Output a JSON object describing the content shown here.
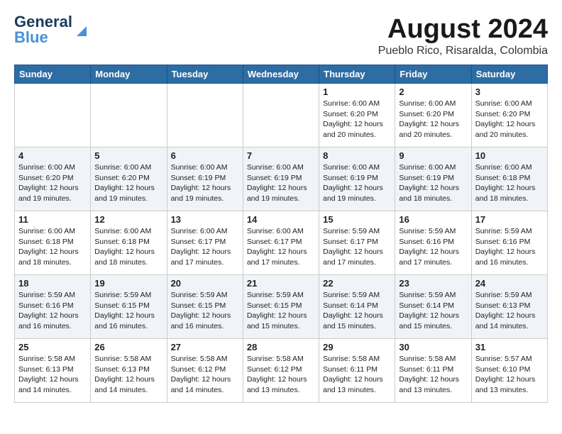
{
  "header": {
    "logo_line1": "General",
    "logo_line2": "Blue",
    "title": "August 2024",
    "subtitle": "Pueblo Rico, Risaralda, Colombia"
  },
  "weekdays": [
    "Sunday",
    "Monday",
    "Tuesday",
    "Wednesday",
    "Thursday",
    "Friday",
    "Saturday"
  ],
  "weeks": [
    [
      {
        "day": "",
        "info": ""
      },
      {
        "day": "",
        "info": ""
      },
      {
        "day": "",
        "info": ""
      },
      {
        "day": "",
        "info": ""
      },
      {
        "day": "1",
        "info": "Sunrise: 6:00 AM\nSunset: 6:20 PM\nDaylight: 12 hours\nand 20 minutes."
      },
      {
        "day": "2",
        "info": "Sunrise: 6:00 AM\nSunset: 6:20 PM\nDaylight: 12 hours\nand 20 minutes."
      },
      {
        "day": "3",
        "info": "Sunrise: 6:00 AM\nSunset: 6:20 PM\nDaylight: 12 hours\nand 20 minutes."
      }
    ],
    [
      {
        "day": "4",
        "info": "Sunrise: 6:00 AM\nSunset: 6:20 PM\nDaylight: 12 hours\nand 19 minutes."
      },
      {
        "day": "5",
        "info": "Sunrise: 6:00 AM\nSunset: 6:20 PM\nDaylight: 12 hours\nand 19 minutes."
      },
      {
        "day": "6",
        "info": "Sunrise: 6:00 AM\nSunset: 6:19 PM\nDaylight: 12 hours\nand 19 minutes."
      },
      {
        "day": "7",
        "info": "Sunrise: 6:00 AM\nSunset: 6:19 PM\nDaylight: 12 hours\nand 19 minutes."
      },
      {
        "day": "8",
        "info": "Sunrise: 6:00 AM\nSunset: 6:19 PM\nDaylight: 12 hours\nand 19 minutes."
      },
      {
        "day": "9",
        "info": "Sunrise: 6:00 AM\nSunset: 6:19 PM\nDaylight: 12 hours\nand 18 minutes."
      },
      {
        "day": "10",
        "info": "Sunrise: 6:00 AM\nSunset: 6:18 PM\nDaylight: 12 hours\nand 18 minutes."
      }
    ],
    [
      {
        "day": "11",
        "info": "Sunrise: 6:00 AM\nSunset: 6:18 PM\nDaylight: 12 hours\nand 18 minutes."
      },
      {
        "day": "12",
        "info": "Sunrise: 6:00 AM\nSunset: 6:18 PM\nDaylight: 12 hours\nand 18 minutes."
      },
      {
        "day": "13",
        "info": "Sunrise: 6:00 AM\nSunset: 6:17 PM\nDaylight: 12 hours\nand 17 minutes."
      },
      {
        "day": "14",
        "info": "Sunrise: 6:00 AM\nSunset: 6:17 PM\nDaylight: 12 hours\nand 17 minutes."
      },
      {
        "day": "15",
        "info": "Sunrise: 5:59 AM\nSunset: 6:17 PM\nDaylight: 12 hours\nand 17 minutes."
      },
      {
        "day": "16",
        "info": "Sunrise: 5:59 AM\nSunset: 6:16 PM\nDaylight: 12 hours\nand 17 minutes."
      },
      {
        "day": "17",
        "info": "Sunrise: 5:59 AM\nSunset: 6:16 PM\nDaylight: 12 hours\nand 16 minutes."
      }
    ],
    [
      {
        "day": "18",
        "info": "Sunrise: 5:59 AM\nSunset: 6:16 PM\nDaylight: 12 hours\nand 16 minutes."
      },
      {
        "day": "19",
        "info": "Sunrise: 5:59 AM\nSunset: 6:15 PM\nDaylight: 12 hours\nand 16 minutes."
      },
      {
        "day": "20",
        "info": "Sunrise: 5:59 AM\nSunset: 6:15 PM\nDaylight: 12 hours\nand 16 minutes."
      },
      {
        "day": "21",
        "info": "Sunrise: 5:59 AM\nSunset: 6:15 PM\nDaylight: 12 hours\nand 15 minutes."
      },
      {
        "day": "22",
        "info": "Sunrise: 5:59 AM\nSunset: 6:14 PM\nDaylight: 12 hours\nand 15 minutes."
      },
      {
        "day": "23",
        "info": "Sunrise: 5:59 AM\nSunset: 6:14 PM\nDaylight: 12 hours\nand 15 minutes."
      },
      {
        "day": "24",
        "info": "Sunrise: 5:59 AM\nSunset: 6:13 PM\nDaylight: 12 hours\nand 14 minutes."
      }
    ],
    [
      {
        "day": "25",
        "info": "Sunrise: 5:58 AM\nSunset: 6:13 PM\nDaylight: 12 hours\nand 14 minutes."
      },
      {
        "day": "26",
        "info": "Sunrise: 5:58 AM\nSunset: 6:13 PM\nDaylight: 12 hours\nand 14 minutes."
      },
      {
        "day": "27",
        "info": "Sunrise: 5:58 AM\nSunset: 6:12 PM\nDaylight: 12 hours\nand 14 minutes."
      },
      {
        "day": "28",
        "info": "Sunrise: 5:58 AM\nSunset: 6:12 PM\nDaylight: 12 hours\nand 13 minutes."
      },
      {
        "day": "29",
        "info": "Sunrise: 5:58 AM\nSunset: 6:11 PM\nDaylight: 12 hours\nand 13 minutes."
      },
      {
        "day": "30",
        "info": "Sunrise: 5:58 AM\nSunset: 6:11 PM\nDaylight: 12 hours\nand 13 minutes."
      },
      {
        "day": "31",
        "info": "Sunrise: 5:57 AM\nSunset: 6:10 PM\nDaylight: 12 hours\nand 13 minutes."
      }
    ]
  ]
}
